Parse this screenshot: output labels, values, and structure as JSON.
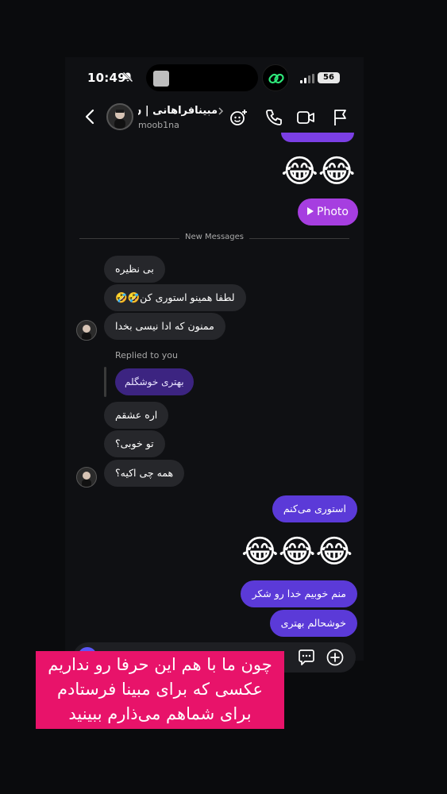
{
  "status_bar": {
    "time": "10:49",
    "battery": "56"
  },
  "header": {
    "name": "مبینافراهانی | ن...",
    "username": "moob1na"
  },
  "chat": {
    "photo_label": "Photo",
    "new_messages_label": "New Messages",
    "messages_in": [
      "بی نظیره",
      "لطفا همینو استوری کن🤣🤣",
      "ممنون که ادا نیسی بخدا",
      "اره عشقم",
      "تو خوبی؟",
      "همه چی اکیه؟"
    ],
    "replied_label": "Replied to you",
    "reply_text": "بهتری خوشگلم",
    "messages_out": [
      "استوری می‌کنم",
      "منم خوبیم خدا رو شکر",
      "خوشحالم بهتری"
    ],
    "emoji_top": "😂😂",
    "emoji_mid": "😂😂😂"
  },
  "caption": {
    "line1": "چون ما با هم این حرفا رو نداریم",
    "line2": "عکسی که برای مبینا فرستادم",
    "line3": "برای شماهم می‌ذارم ببینید"
  },
  "colors": {
    "accent_purple": "#5b3ad8",
    "photo_bubble": "#a63ee0",
    "caption_bg": "#e8136a"
  }
}
